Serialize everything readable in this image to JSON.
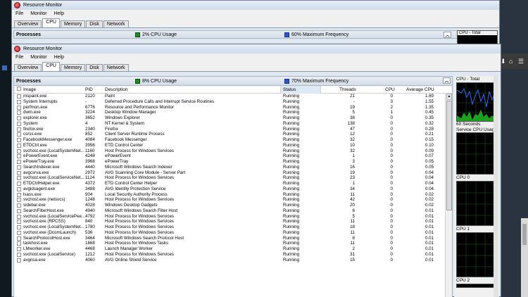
{
  "back_window": {
    "title": "Resource Monitor",
    "menu": [
      "File",
      "Monitor",
      "Help"
    ],
    "tabs": [
      "Overview",
      "CPU",
      "Memory",
      "Disk",
      "Network"
    ],
    "processes_label": "Processes",
    "cpu_usage": "2% CPU Usage",
    "max_freq": "60% Maximum Frequency",
    "graph_label": "CPU - Total"
  },
  "front_window": {
    "title": "Resource Monitor",
    "menu": [
      "File",
      "Monitor",
      "Help"
    ],
    "tabs": [
      "Overview",
      "CPU",
      "Memory",
      "Disk",
      "Network"
    ],
    "active_tab": "CPU",
    "processes_label": "Processes",
    "cpu_usage": "8% CPU Usage",
    "max_freq": "70% Maximum Frequency",
    "columns": [
      "Image",
      "PID",
      "Description",
      "Status",
      "Threads",
      "CPU",
      "Average CPU"
    ],
    "processes": [
      {
        "image": "mspaint.exe",
        "pid": "2120",
        "desc": "Paint",
        "status": "Running",
        "threads": "21",
        "cpu": "0",
        "avg": "1.69"
      },
      {
        "image": "System Interrupts",
        "pid": "-",
        "desc": "Deferred Procedure Calls and Interrupt Service Routines",
        "status": "Running",
        "threads": "-",
        "cpu": "3",
        "avg": "1.55"
      },
      {
        "image": "perfmon.exe",
        "pid": "6776",
        "desc": "Resource and Performance Monitor",
        "status": "Running",
        "threads": "19",
        "cpu": "2",
        "avg": "1.35"
      },
      {
        "image": "dwm.exe",
        "pid": "3224",
        "desc": "Desktop Window Manager",
        "status": "Running",
        "threads": "5",
        "cpu": "1",
        "avg": "0.45"
      },
      {
        "image": "explorer.exe",
        "pid": "3652",
        "desc": "Windows Explorer",
        "status": "Running",
        "threads": "38",
        "cpu": "0",
        "avg": "0.35"
      },
      {
        "image": "System",
        "pid": "4",
        "desc": "NT Kernel & System",
        "status": "Running",
        "threads": "138",
        "cpu": "0",
        "avg": "0.32"
      },
      {
        "image": "firefox.exe",
        "pid": "2340",
        "desc": "Firefox",
        "status": "Running",
        "threads": "47",
        "cpu": "0",
        "avg": "0.28"
      },
      {
        "image": "csrss.exe",
        "pid": "852",
        "desc": "Client Server Runtime Process",
        "status": "Running",
        "threads": "12",
        "cpu": "0",
        "avg": "0.21"
      },
      {
        "image": "FacebookMessenger.exe",
        "pid": "4084",
        "desc": "Facebook Messenger",
        "status": "Running",
        "threads": "32",
        "cpu": "0",
        "avg": "0.15"
      },
      {
        "image": "ETDCtrl.exe",
        "pid": "3956",
        "desc": "ETD Control Center",
        "status": "Running",
        "threads": "10",
        "cpu": "0",
        "avg": "0.10"
      },
      {
        "image": "svchost.exe (LocalSystemNet...",
        "pid": "1160",
        "desc": "Host Process for Windows Services",
        "status": "Running",
        "threads": "32",
        "cpu": "0",
        "avg": "0.09"
      },
      {
        "image": "ePowerEvent.exe",
        "pid": "4248",
        "desc": "ePowerEvent",
        "status": "Running",
        "threads": "1",
        "cpu": "0",
        "avg": "0.07"
      },
      {
        "image": "ePowerTray.exe",
        "pid": "3968",
        "desc": "ePowerTray",
        "status": "Running",
        "threads": "3",
        "cpu": "0",
        "avg": "0.05"
      },
      {
        "image": "SearchIndexer.exe",
        "pid": "4440",
        "desc": "Microsoft Windows Search Indexer",
        "status": "Running",
        "threads": "16",
        "cpu": "0",
        "avg": "0.05"
      },
      {
        "image": "avgcsrva.exe",
        "pid": "2972",
        "desc": "AVG Scanning Core Module - Server Part",
        "status": "Running",
        "threads": "19",
        "cpu": "0",
        "avg": "0.04"
      },
      {
        "image": "svchost.exe (LocalServiceNet...",
        "pid": "1124",
        "desc": "Host Process for Windows Services",
        "status": "Running",
        "threads": "23",
        "cpu": "0",
        "avg": "0.04"
      },
      {
        "image": "ETDCtrlHelper.exe",
        "pid": "4372",
        "desc": "ETD Control Center Helper",
        "status": "Running",
        "threads": "1",
        "cpu": "0",
        "avg": "0.04"
      },
      {
        "image": "avgidsagent.exe",
        "pid": "3488",
        "desc": "AVG Identity Protection Service",
        "status": "Running",
        "threads": "34",
        "cpu": "0",
        "avg": "0.04"
      },
      {
        "image": "lsass.exe",
        "pid": "904",
        "desc": "Local Security Authority Process",
        "status": "Running",
        "threads": "11",
        "cpu": "0",
        "avg": "0.02"
      },
      {
        "image": "svchost.exe (netsvcs)",
        "pid": "1248",
        "desc": "Host Process for Windows Services",
        "status": "Running",
        "threads": "42",
        "cpu": "0",
        "avg": "0.02"
      },
      {
        "image": "sidebar.exe",
        "pid": "4028",
        "desc": "Windows Desktop Gadgets",
        "status": "Running",
        "threads": "20",
        "cpu": "0",
        "avg": "0.02"
      },
      {
        "image": "SearchFilterHost.exe",
        "pid": "4940",
        "desc": "Microsoft Windows Search Filter Host",
        "status": "Running",
        "threads": "6",
        "cpu": "0",
        "avg": "0.01"
      },
      {
        "image": "svchost.exe (LocalServicePee...",
        "pid": "4792",
        "desc": "Host Process for Windows Services",
        "status": "Running",
        "threads": "5",
        "cpu": "0",
        "avg": "0.01"
      },
      {
        "image": "svchost.exe (RPCSS)",
        "pid": "840",
        "desc": "Host Process for Windows Services",
        "status": "Running",
        "threads": "11",
        "cpu": "0",
        "avg": "0.01"
      },
      {
        "image": "svchost.exe (LocalSystemNet...",
        "pid": "1780",
        "desc": "Host Process for Windows Services",
        "status": "Running",
        "threads": "18",
        "cpu": "0",
        "avg": "0.01"
      },
      {
        "image": "svchost.exe (DcomLaunch)",
        "pid": "536",
        "desc": "Host Process for Windows Services",
        "status": "Running",
        "threads": "11",
        "cpu": "0",
        "avg": "0.01"
      },
      {
        "image": "SearchProtocolHost.exe",
        "pid": "3464",
        "desc": "Microsoft Windows Search Protocol Host",
        "status": "Running",
        "threads": "8",
        "cpu": "0",
        "avg": "0.01"
      },
      {
        "image": "taskhost.exe",
        "pid": "1668",
        "desc": "Host Process for Windows Tasks",
        "status": "Running",
        "threads": "11",
        "cpu": "0",
        "avg": "0.01"
      },
      {
        "image": "LMworker.exe",
        "pid": "4468",
        "desc": "Launch Manager Worker",
        "status": "Running",
        "threads": "2",
        "cpu": "0",
        "avg": "0.01"
      },
      {
        "image": "svchost.exe (LocalService)",
        "pid": "1212",
        "desc": "Host Process for Windows Services",
        "status": "Running",
        "threads": "31",
        "cpu": "0",
        "avg": "0.01"
      },
      {
        "image": "avgnsa.exe",
        "pid": "4060",
        "desc": "AVG Online Shield Service",
        "status": "Running",
        "threads": "15",
        "cpu": "0",
        "avg": "0.01"
      }
    ],
    "graphs": {
      "total_label": "CPU - Total",
      "sub_line1": "60 Seconds",
      "sub_line2": "Service CPU Usag",
      "cpu0": "CPU 0",
      "cpu1": "CPU 1",
      "cpu2": "CPU 2"
    }
  }
}
